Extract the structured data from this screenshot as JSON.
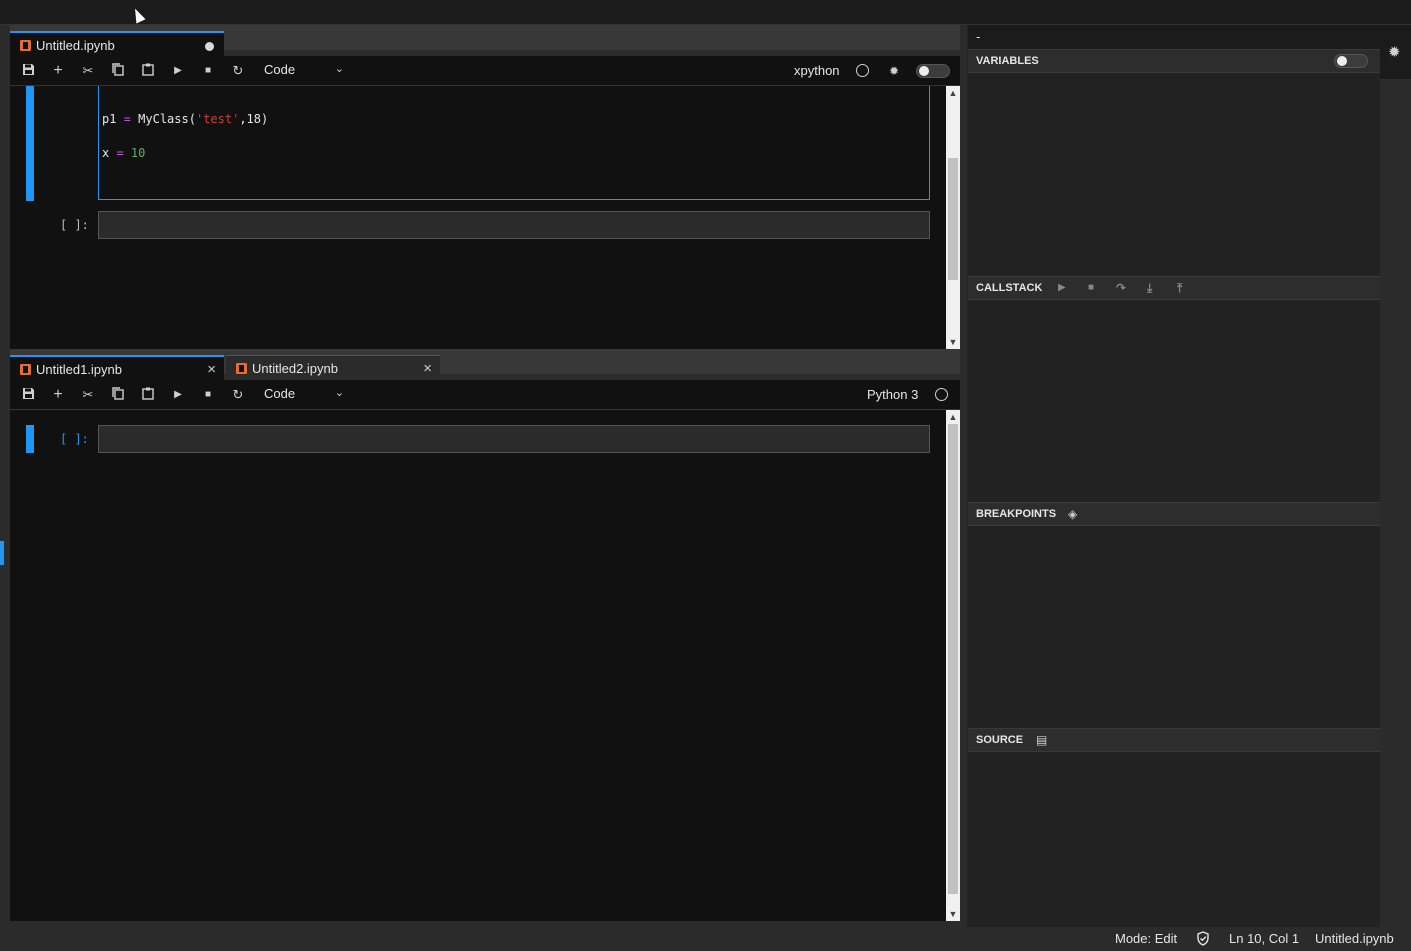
{
  "panel1": {
    "tab": {
      "label": "Untitled.ipynb"
    },
    "toolbar": {
      "cell_type": "Code",
      "kernel": "xpython"
    },
    "code_lines": [
      {
        "parts": [
          {
            "t": "p1 ",
            "c": ""
          },
          {
            "t": "=",
            "c": "op"
          },
          {
            "t": " MyClass(",
            "c": ""
          },
          {
            "t": "'test'",
            "c": "str"
          },
          {
            "t": ",18)",
            "c": ""
          }
        ]
      },
      {
        "parts": [
          {
            "t": "x ",
            "c": ""
          },
          {
            "t": "=",
            "c": "op"
          },
          {
            "t": " ",
            "c": ""
          },
          {
            "t": "10",
            "c": "num"
          }
        ]
      }
    ],
    "prompt": "[ ]:"
  },
  "panel2": {
    "tabs": [
      {
        "label": "Untitled1.ipynb"
      },
      {
        "label": "Untitled2.ipynb"
      }
    ],
    "toolbar": {
      "cell_type": "Code",
      "kernel": "Python 3"
    },
    "prompt": "[ ]:"
  },
  "sidebar": {
    "top_label": "-",
    "panels": {
      "variables": "VARIABLES",
      "callstack": "CALLSTACK",
      "breakpoints": "BREAKPOINTS",
      "source": "SOURCE"
    }
  },
  "statusbar": {
    "mode": "Mode: Edit",
    "position": "Ln 10, Col 1",
    "file": "Untitled.ipynb"
  },
  "icons": {
    "save": "save-icon",
    "add": "plus-icon",
    "cut": "scissors-icon",
    "copy": "copy-icon",
    "paste": "paste-icon",
    "run": "play-icon",
    "stop": "stop-icon",
    "restart": "refresh-icon",
    "kernel_status": "circle-icon",
    "debug": "bug-icon"
  },
  "colors": {
    "accent": "#2196f3",
    "notebook_icon": "#e46e2e"
  }
}
